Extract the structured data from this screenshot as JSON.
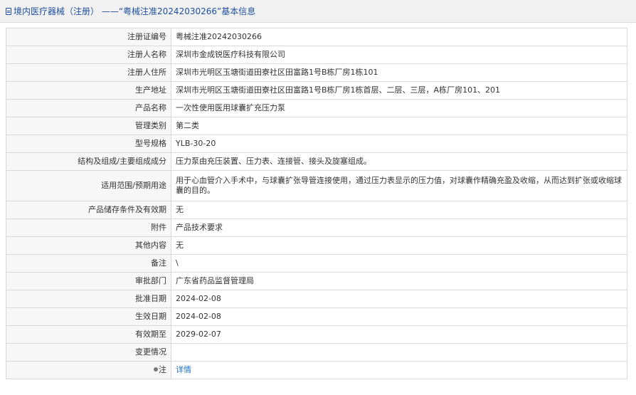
{
  "header": {
    "title": "境内医疗器械（注册） ——“粤械注准20242030266”基本信息"
  },
  "rows": [
    {
      "label": "注册证编号",
      "value": "粤械注准20242030266"
    },
    {
      "label": "注册人名称",
      "value": "深圳市金成锐医疗科技有限公司"
    },
    {
      "label": "注册人住所",
      "value": "深圳市光明区玉塘街道田寮社区田富路1号B栋厂房1栋101"
    },
    {
      "label": "生产地址",
      "value": "深圳市光明区玉塘街道田寮社区田富路1号B栋厂房1栋首层、二层、三层，A栋厂房101、201"
    },
    {
      "label": "产品名称",
      "value": "一次性使用医用球囊扩充压力泵"
    },
    {
      "label": "管理类别",
      "value": "第二类"
    },
    {
      "label": "型号规格",
      "value": "YLB-30-20"
    },
    {
      "label": "结构及组成/主要组成成分",
      "value": "压力泵由充压装置、压力表、连接管、接头及旋塞组成。"
    },
    {
      "label": "适用范围/预期用途",
      "value": "用于心血管介入手术中，与球囊扩张导管连接使用，通过压力表显示的压力值，对球囊作精确充盈及收缩，从而达到扩张或收缩球囊的目的。"
    },
    {
      "label": "产品储存条件及有效期",
      "value": "无"
    },
    {
      "label": "附件",
      "value": "产品技术要求"
    },
    {
      "label": "其他内容",
      "value": "无"
    },
    {
      "label": "备注",
      "value": "\\"
    },
    {
      "label": "审批部门",
      "value": "广东省药品监督管理局"
    },
    {
      "label": "批准日期",
      "value": "2024-02-08"
    },
    {
      "label": "生效日期",
      "value": "2024-02-08"
    },
    {
      "label": "有效期至",
      "value": "2029-02-07"
    },
    {
      "label": "变更情况",
      "value": ""
    }
  ],
  "note_row": {
    "label": "注",
    "link_text": "详情",
    "icon": "note-icon"
  }
}
